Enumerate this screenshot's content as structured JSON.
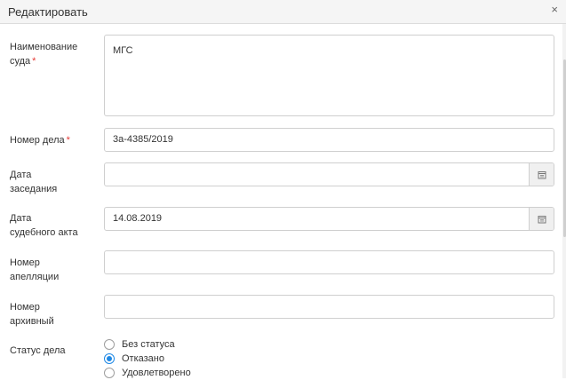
{
  "dialog": {
    "title": "Редактировать",
    "close_glyph": "×"
  },
  "form": {
    "court_name": {
      "label_line1": "Наименование",
      "label_line2": "суда",
      "required_mark": "*",
      "value": "МГС"
    },
    "case_number": {
      "label": "Номер дела",
      "required_mark": "*",
      "value": "3а-4385/2019"
    },
    "session_date": {
      "label_line1": "Дата",
      "label_line2": "заседания",
      "value": "",
      "button_icon": "calendar-icon"
    },
    "act_date": {
      "label_line1": "Дата",
      "label_line2": "судебного акта",
      "value": "14.08.2019",
      "button_icon": "calendar-icon"
    },
    "appeal_number": {
      "label_line1": "Номер",
      "label_line2": "апелляции",
      "value": ""
    },
    "archive_number": {
      "label_line1": "Номер",
      "label_line2": "архивный",
      "value": ""
    },
    "case_status": {
      "label": "Статус дела",
      "options": [
        {
          "label": "Без статуса",
          "checked": false
        },
        {
          "label": "Отказано",
          "checked": true
        },
        {
          "label": "Удовлетворено",
          "checked": false
        }
      ]
    }
  },
  "colors": {
    "accent": "#1e88e5",
    "required": "#e53935",
    "border": "#cfcfcf"
  }
}
